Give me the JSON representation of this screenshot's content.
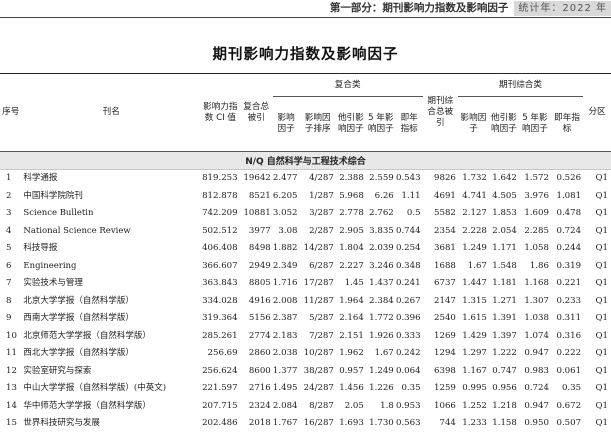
{
  "running_head": {
    "section": "第一部分：期刊影响力指数及影响因子",
    "year_tag": "统计年：2022 年"
  },
  "table_title": "期刊影响力指数及影响因子",
  "headers": {
    "no": "序号",
    "journal": "刊名",
    "ci": "影响力指数 CI 值",
    "composite_group": "复合类",
    "comp_total_cites": "复合总被引",
    "comp_if": "影响因子",
    "comp_if_rank": "影响因子排序",
    "comp_other_ratio": "他引影响因子",
    "comp_5yr_if": "5 年影响因子",
    "comp_immediacy": "即年指标",
    "journal_total_cites": "期刊综合总被引",
    "general_group": "期刊综合类",
    "gen_if": "影响因子",
    "gen_other_ratio": "他引影响因子",
    "gen_5yr_if": "5 年影响因子",
    "gen_immediacy": "即年指标",
    "zone": "分区"
  },
  "band_label": "N/Q  自然科学与工程技术综合",
  "rows": [
    {
      "no": "1",
      "name": "科学通报",
      "ci": "819.253",
      "tc": "19642",
      "if": "2.477",
      "rank": "4/287",
      "oif": "2.388",
      "if5": "2.559",
      "imm": "0.543",
      "jtc": "9826",
      "gif": "1.732",
      "goif": "1.642",
      "gif5": "1.572",
      "gimm": "0.526",
      "zone": "Q1"
    },
    {
      "no": "2",
      "name": "中国科学院院刊",
      "ci": "812.878",
      "tc": "8521",
      "if": "6.205",
      "rank": "1/287",
      "oif": "5.968",
      "if5": "6.26",
      "imm": "1.11",
      "jtc": "4691",
      "gif": "4.741",
      "goif": "4.505",
      "gif5": "3.976",
      "gimm": "1.081",
      "zone": "Q1"
    },
    {
      "no": "3",
      "name": "Science Bulletin",
      "ci": "742.209",
      "tc": "10881",
      "if": "3.052",
      "rank": "3/287",
      "oif": "2.778",
      "if5": "2.762",
      "imm": "0.5",
      "jtc": "5582",
      "gif": "2.127",
      "goif": "1.853",
      "gif5": "1.609",
      "gimm": "0.478",
      "zone": "Q1"
    },
    {
      "no": "4",
      "name": "National Science Review",
      "ci": "502.512",
      "tc": "3977",
      "if": "3.08",
      "rank": "2/287",
      "oif": "2.905",
      "if5": "3.835",
      "imm": "0.744",
      "jtc": "2354",
      "gif": "2.228",
      "goif": "2.054",
      "gif5": "2.285",
      "gimm": "0.724",
      "zone": "Q1"
    },
    {
      "no": "5",
      "name": "科技导报",
      "ci": "406.408",
      "tc": "8498",
      "if": "1.882",
      "rank": "14/287",
      "oif": "1.804",
      "if5": "2.039",
      "imm": "0.254",
      "jtc": "3681",
      "gif": "1.249",
      "goif": "1.171",
      "gif5": "1.058",
      "gimm": "0.244",
      "zone": "Q1"
    },
    {
      "no": "6",
      "name": "Engineering",
      "ci": "366.607",
      "tc": "2949",
      "if": "2.349",
      "rank": "6/287",
      "oif": "2.227",
      "if5": "3.246",
      "imm": "0.348",
      "jtc": "1688",
      "gif": "1.67",
      "goif": "1.548",
      "gif5": "1.86",
      "gimm": "0.319",
      "zone": "Q1"
    },
    {
      "no": "7",
      "name": "实验技术与管理",
      "ci": "363.843",
      "tc": "8805",
      "if": "1.716",
      "rank": "17/287",
      "oif": "1.45",
      "if5": "1.437",
      "imm": "0.241",
      "jtc": "6737",
      "gif": "1.447",
      "goif": "1.181",
      "gif5": "1.168",
      "gimm": "0.221",
      "zone": "Q1"
    },
    {
      "no": "8",
      "name": "北京大学学报（自然科学版）",
      "ci": "334.028",
      "tc": "4916",
      "if": "2.008",
      "rank": "11/287",
      "oif": "1.964",
      "if5": "2.384",
      "imm": "0.267",
      "jtc": "2147",
      "gif": "1.315",
      "goif": "1.271",
      "gif5": "1.307",
      "gimm": "0.233",
      "zone": "Q1"
    },
    {
      "no": "9",
      "name": "西南大学学报（自然科学版）",
      "ci": "319.364",
      "tc": "5156",
      "if": "2.387",
      "rank": "5/287",
      "oif": "2.164",
      "if5": "1.772",
      "imm": "0.396",
      "jtc": "2540",
      "gif": "1.615",
      "goif": "1.391",
      "gif5": "1.038",
      "gimm": "0.311",
      "zone": "Q1"
    },
    {
      "no": "10",
      "name": "北京师范大学学报（自然科学版）",
      "ci": "285.261",
      "tc": "2774",
      "if": "2.183",
      "rank": "7/287",
      "oif": "2.151",
      "if5": "1.926",
      "imm": "0.333",
      "jtc": "1269",
      "gif": "1.429",
      "goif": "1.397",
      "gif5": "1.074",
      "gimm": "0.316",
      "zone": "Q1"
    },
    {
      "no": "11",
      "name": "西北大学学报（自然科学版）",
      "ci": "256.69",
      "tc": "2860",
      "if": "2.038",
      "rank": "10/287",
      "oif": "1.962",
      "if5": "1.67",
      "imm": "0.242",
      "jtc": "1294",
      "gif": "1.297",
      "goif": "1.222",
      "gif5": "0.947",
      "gimm": "0.222",
      "zone": "Q1"
    },
    {
      "no": "12",
      "name": "实验室研究与探索",
      "ci": "256.624",
      "tc": "8600",
      "if": "1.377",
      "rank": "38/287",
      "oif": "0.957",
      "if5": "1.249",
      "imm": "0.064",
      "jtc": "6398",
      "gif": "1.167",
      "goif": "0.747",
      "gif5": "0.983",
      "gimm": "0.061",
      "zone": "Q1"
    },
    {
      "no": "13",
      "name": "中山大学学报（自然科学版）(中英文)",
      "ci": "221.597",
      "tc": "2716",
      "if": "1.495",
      "rank": "24/287",
      "oif": "1.456",
      "if5": "1.226",
      "imm": "0.35",
      "jtc": "1259",
      "gif": "0.995",
      "goif": "0.956",
      "gif5": "0.724",
      "gimm": "0.35",
      "zone": "Q1"
    },
    {
      "no": "14",
      "name": "华中师范大学学报（自然科学版）",
      "ci": "207.715",
      "tc": "2324",
      "if": "2.084",
      "rank": "8/287",
      "oif": "2.05",
      "if5": "1.8",
      "imm": "0.953",
      "jtc": "1066",
      "gif": "1.252",
      "goif": "1.218",
      "gif5": "0.947",
      "gimm": "0.672",
      "zone": "Q1"
    },
    {
      "no": "15",
      "name": "世界科技研究与发展",
      "ci": "202.486",
      "tc": "2018",
      "if": "1.767",
      "rank": "16/287",
      "oif": "1.693",
      "if5": "1.730",
      "imm": "0.563",
      "jtc": "744",
      "gif": "1.233",
      "goif": "1.158",
      "gif5": "0.950",
      "gimm": "0.507",
      "zone": "Q1"
    }
  ]
}
